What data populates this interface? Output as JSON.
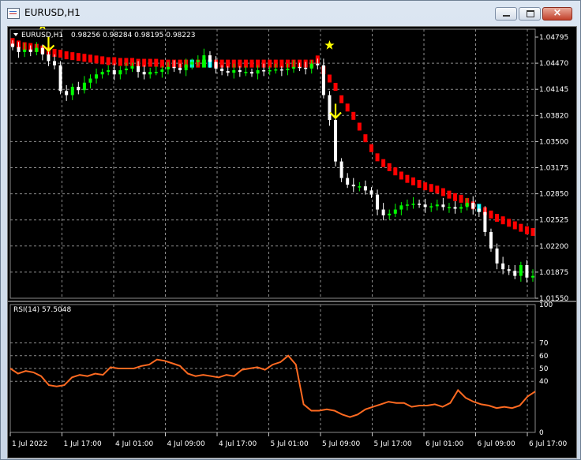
{
  "window": {
    "title": "EURUSD,H1",
    "close_glyph": "×"
  },
  "chart_data": [
    {
      "type": "candlestick",
      "title": "EURUSD,H1",
      "ohlc_text": "0.98256 0.98284 0.98195 0.98223",
      "y_ticks": [
        "1.04795",
        "1.04470",
        "1.04145",
        "1.03820",
        "1.03500",
        "1.03175",
        "1.02850",
        "1.02525",
        "1.02200",
        "1.01875",
        "1.01550"
      ],
      "ylim": [
        1.0155,
        1.04795
      ],
      "x_ticks": [
        "1 Jul 2022",
        "1 Jul 17:00",
        "4 Jul 01:00",
        "4 Jul 09:00",
        "4 Jul 17:00",
        "5 Jul 01:00",
        "5 Jul 09:00",
        "5 Jul 17:00",
        "6 Jul 01:00",
        "6 Jul 09:00",
        "6 Jul 17:00"
      ],
      "grid": true,
      "colors": {
        "bull": "#00ff00",
        "bear": "#ffffff",
        "band_bear": "#ff0000",
        "band_bull": "#00ff00",
        "band_neutral": "#00ffff",
        "marker_star": "#ffff00",
        "marker_arrow": "#ffff00"
      },
      "closes": [
        1.0458,
        1.0452,
        1.0455,
        1.0452,
        1.0457,
        1.0449,
        1.0441,
        1.0436,
        1.0405,
        1.04,
        1.041,
        1.0406,
        1.0415,
        1.042,
        1.0425,
        1.0428,
        1.043,
        1.0425,
        1.043,
        1.0432,
        1.0435,
        1.0428,
        1.0425,
        1.0428,
        1.0428,
        1.0431,
        1.0434,
        1.0433,
        1.043,
        1.0437,
        1.044,
        1.0442,
        1.0448,
        1.044,
        1.0432,
        1.0429,
        1.0427,
        1.043,
        1.0428,
        1.0428,
        1.0426,
        1.043,
        1.0429,
        1.043,
        1.0431,
        1.043,
        1.0432,
        1.0434,
        1.0433,
        1.0432,
        1.0438,
        1.0436,
        1.04,
        1.037,
        1.032,
        1.03,
        1.0292,
        1.029,
        1.029,
        1.0285,
        1.028,
        1.0262,
        1.0255,
        1.0257,
        1.0262,
        1.0267,
        1.0268,
        1.0269,
        1.0268,
        1.0265,
        1.0266,
        1.0268,
        1.0265,
        1.0265,
        1.0263,
        1.0265,
        1.027,
        1.0263,
        1.0259,
        1.0235,
        1.0215,
        1.0197,
        1.019,
        1.0188,
        1.0182,
        1.0195,
        1.018,
        1.0182
      ],
      "band": [
        1.0464,
        1.0461,
        1.0459,
        1.0458,
        1.0457,
        1.0455,
        1.0453,
        1.0451,
        1.045,
        1.0448,
        1.0447,
        1.0446,
        1.0445,
        1.0444,
        1.0443,
        1.0442,
        1.0441,
        1.0441,
        1.044,
        1.044,
        1.044,
        1.0439,
        1.0439,
        1.0439,
        1.0439,
        1.0438,
        1.0438,
        1.0438,
        1.0438,
        1.0438,
        1.0438,
        1.0438,
        1.0438,
        1.0438,
        1.0438,
        1.0438,
        1.0438,
        1.0438,
        1.0438,
        1.0438,
        1.0438,
        1.0438,
        1.0438,
        1.0438,
        1.0438,
        1.0438,
        1.0438,
        1.0438,
        1.0438,
        1.0438,
        1.0438,
        1.0443,
        1.043,
        1.042,
        1.041,
        1.0395,
        1.0385,
        1.0375,
        1.0362,
        1.0348,
        1.0336,
        1.0325,
        1.0318,
        1.0313,
        1.0308,
        1.0303,
        1.0299,
        1.0296,
        1.0293,
        1.029,
        1.0288,
        1.0286,
        1.0283,
        1.028,
        1.0277,
        1.0275,
        1.0271,
        1.0267,
        1.0264,
        1.026,
        1.0256,
        1.0252,
        1.0249,
        1.0246,
        1.0243,
        1.024,
        1.0237,
        1.0235
      ]
    },
    {
      "type": "line",
      "title": "RSI(14) 57.5048",
      "y_ticks": [
        "100",
        "70",
        "60",
        "50",
        "40",
        "0"
      ],
      "ylim": [
        0,
        100
      ],
      "line_color": "#ff6a21",
      "values": [
        50,
        46,
        48,
        47,
        44,
        37,
        36,
        37,
        43,
        45,
        44,
        46,
        45,
        51,
        50,
        50,
        50,
        52,
        53,
        57,
        56,
        54,
        52,
        46,
        44,
        45,
        44,
        43,
        45,
        44,
        49,
        50,
        51,
        49,
        53,
        55,
        60,
        53,
        22,
        17,
        17,
        18,
        17,
        14,
        12,
        14,
        18,
        20,
        22,
        24,
        23,
        23,
        20,
        21,
        21,
        22,
        20,
        23,
        33,
        27,
        24,
        22,
        21,
        19,
        20,
        19,
        21,
        28,
        32
      ]
    }
  ]
}
